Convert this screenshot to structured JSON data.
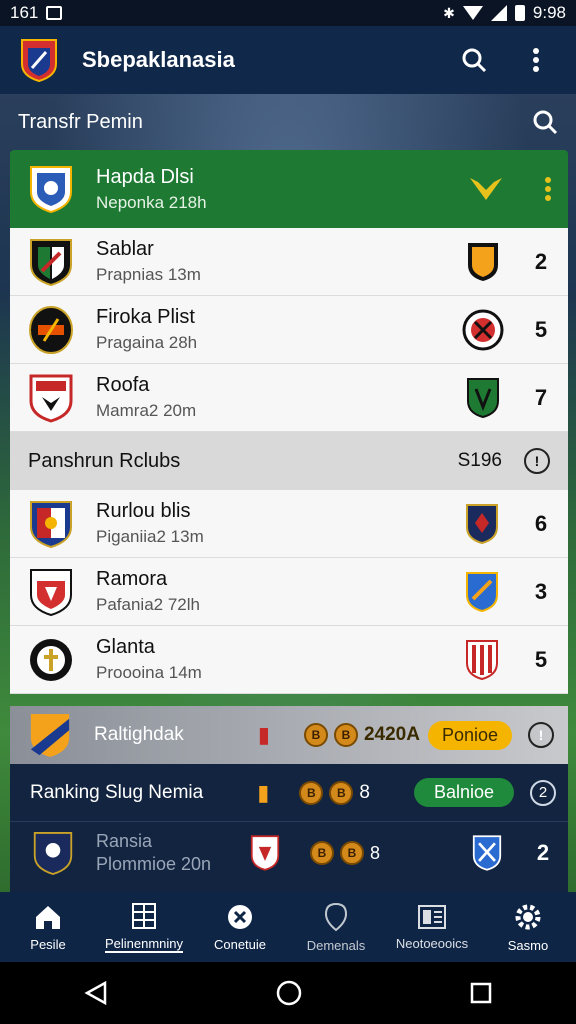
{
  "status": {
    "time": "161",
    "clock": "9:98"
  },
  "appbar": {
    "title": "Sbepaklanasia"
  },
  "section": {
    "title": "Transfr Pemin"
  },
  "featured": {
    "name": "Hapda Dlsi",
    "sub": "Neponka 218h"
  },
  "list1": [
    {
      "name": "Sablar",
      "sub": "Prapnias 13m",
      "score": "2"
    },
    {
      "name": "Firoka Plist",
      "sub": "Pragaina 28h",
      "score": "5"
    },
    {
      "name": "Roofa",
      "sub": "Mamra2 20m",
      "score": "7"
    }
  ],
  "group": {
    "title": "Panshrun Rclubs",
    "count": "S196",
    "info": "!"
  },
  "list2": [
    {
      "name": "Rurlou blis",
      "sub": "Piganiia2 13m",
      "score": "6"
    },
    {
      "name": "Ramora",
      "sub": "Pafania2 72lh",
      "score": "3"
    },
    {
      "name": "Glanta",
      "sub": "Proooina 14m",
      "score": "5"
    }
  ],
  "promo": {
    "label": "Raltighdak",
    "amount": "2420A",
    "pill": "Ponioe",
    "info": "!"
  },
  "dark": {
    "row1_label": "Ranking Slug Nemia",
    "row1_num": "8",
    "row1_pill": "Balnioe",
    "row1_circle": "2",
    "row2_name": "Ransia",
    "row2_sub": "Plommioe 20n",
    "row2_num": "8",
    "row2_score": "2"
  },
  "nav": [
    {
      "label": "Pesile"
    },
    {
      "label": "Pelinenmniny"
    },
    {
      "label": "Conetuie"
    },
    {
      "label": "Demenals"
    },
    {
      "label": "Neotoeooics"
    },
    {
      "label": "Sasmo"
    }
  ],
  "colors": {
    "primary": "#102849",
    "featured": "#1e7a33",
    "pill": "#f4b400",
    "pill_green": "#1f8a3b"
  }
}
